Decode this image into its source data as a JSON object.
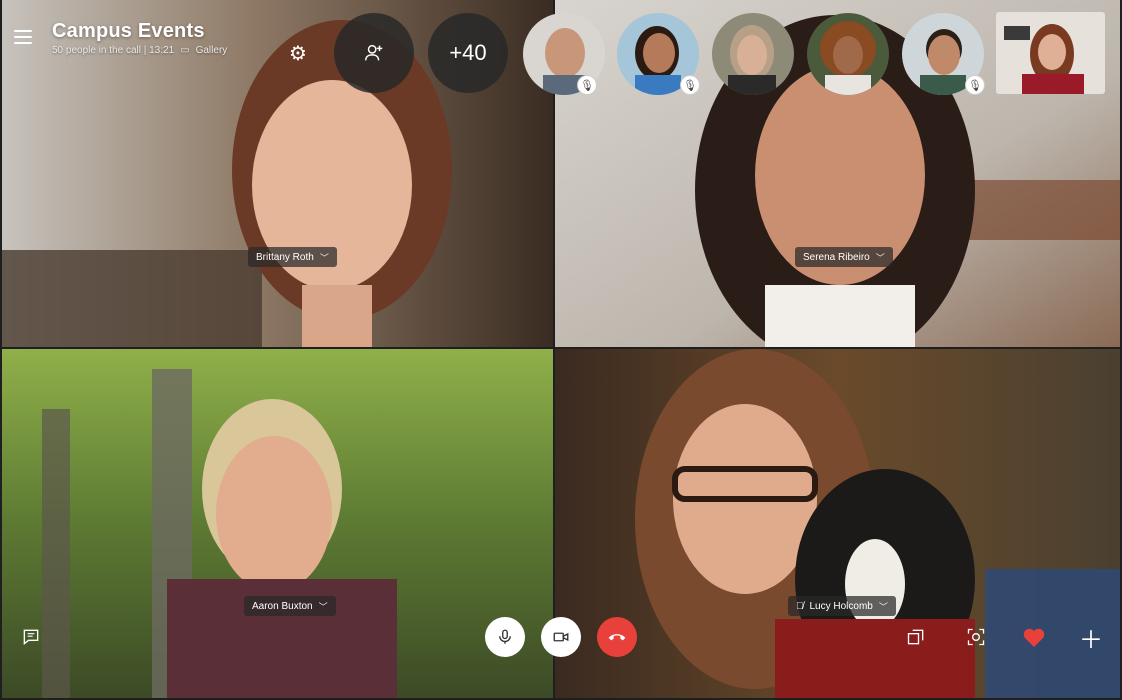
{
  "header": {
    "title": "Campus Events",
    "subtitle": "50 people in the call | 13:21",
    "view_mode": "Gallery",
    "extra_count": "+40"
  },
  "tiles": [
    {
      "id": "tl",
      "name": "Brittany Roth",
      "muted": false
    },
    {
      "id": "tr",
      "name": "Serena Ribeiro",
      "muted": false
    },
    {
      "id": "bl",
      "name": "Aaron Buxton",
      "muted": false
    },
    {
      "id": "br",
      "name": "Lucy Holcomb",
      "muted": true
    }
  ],
  "thumbnails": [
    {
      "muted": true
    },
    {
      "muted": true
    },
    {
      "muted": false
    },
    {
      "muted": false
    },
    {
      "muted": true
    }
  ],
  "icons": {
    "menu": "hamburger-icon",
    "settings": "gear-icon",
    "add_participant": "add-person-icon",
    "chat": "chat-icon",
    "mic": "microphone-icon",
    "camera": "video-camera-icon",
    "hangup": "hang-up-icon",
    "share": "share-screen-icon",
    "snapshot": "snapshot-icon",
    "react": "heart-icon",
    "more": "plus-icon"
  },
  "colors": {
    "end_call": "#e8413b",
    "heart": "#e8413b",
    "pill_bg": "#282828"
  }
}
